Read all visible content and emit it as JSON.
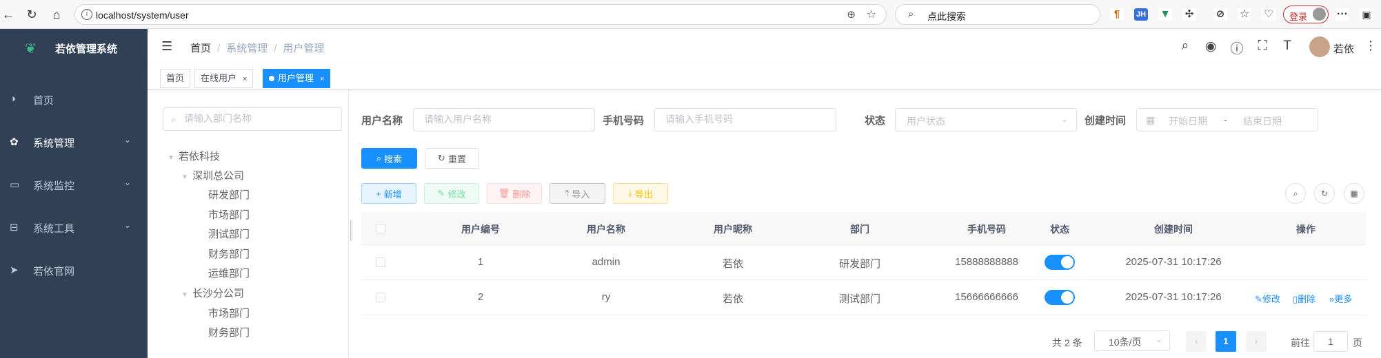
{
  "browser": {
    "url": "localhost/system/user",
    "search_placeholder": "点此搜索",
    "login_label": "登录"
  },
  "sidebar": {
    "title": "若依管理系统",
    "items": [
      {
        "label": "首页",
        "icon": "dashboard-icon"
      },
      {
        "label": "系统管理",
        "icon": "gear-icon"
      },
      {
        "label": "系统监控",
        "icon": "monitor-icon"
      },
      {
        "label": "系统工具",
        "icon": "toolbox-icon"
      },
      {
        "label": "若依官网",
        "icon": "send-icon"
      }
    ]
  },
  "navbar": {
    "breadcrumb": [
      "首页",
      "系统管理",
      "用户管理"
    ],
    "user_name": "若依"
  },
  "tags": [
    {
      "label": "首页"
    },
    {
      "label": "在线用户"
    },
    {
      "label": "用户管理",
      "active": true
    }
  ],
  "dept": {
    "search_placeholder": "请输入部门名称",
    "tree": {
      "root": "若依科技",
      "branch1": "深圳总公司",
      "b1_children": [
        "研发部门",
        "市场部门",
        "测试部门",
        "财务部门",
        "运维部门"
      ],
      "branch2": "长沙分公司",
      "b2_children": [
        "市场部门",
        "财务部门"
      ]
    }
  },
  "filters": {
    "username_label": "用户名称",
    "username_placeholder": "请输入用户名称",
    "phone_label": "手机号码",
    "phone_placeholder": "请输入手机号码",
    "status_label": "状态",
    "status_placeholder": "用户状态",
    "date_label": "创建时间",
    "date_start": "开始日期",
    "date_sep": "-",
    "date_end": "结束日期",
    "search_btn": "搜索",
    "reset_btn": "重置"
  },
  "toolbar": {
    "add": "新增",
    "edit": "修改",
    "delete": "删除",
    "import": "导入",
    "export": "导出"
  },
  "table": {
    "headers": [
      "用户编号",
      "用户名称",
      "用户昵称",
      "部门",
      "手机号码",
      "状态",
      "创建时间",
      "操作"
    ],
    "rows": [
      {
        "id": "1",
        "username": "admin",
        "nickname": "若依",
        "dept": "研发部门",
        "phone": "15888888888",
        "status": true,
        "created": "2025-07-31 10:17:26"
      },
      {
        "id": "2",
        "username": "ry",
        "nickname": "若依",
        "dept": "测试部门",
        "phone": "15666666666",
        "status": true,
        "created": "2025-07-31 10:17:26"
      }
    ],
    "ops": {
      "edit": "修改",
      "delete": "删除",
      "more": "更多"
    }
  },
  "pagination": {
    "total": "共 2 条",
    "page_size": "10条/页",
    "current": "1",
    "goto_label": "前往",
    "goto_value": "1",
    "page_suffix": "页"
  },
  "colors": {
    "sidebar_bg": "#304156",
    "primary": "#1890ff"
  }
}
